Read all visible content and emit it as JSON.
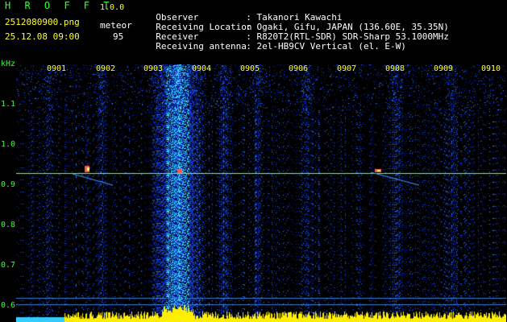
{
  "header": {
    "app_title": "H R O F F T",
    "app_version": "1.0.0",
    "file_name": "2512080900.png",
    "meteor_label": "meteor",
    "datetime": "25.12.08 09:00",
    "meteor_count": "95"
  },
  "info": [
    {
      "key": "Observer",
      "value": ": Takanori Kawachi"
    },
    {
      "key": "Receiving Location",
      "value": ": Ogaki, Gifu, JAPAN (136.60E, 35.35N)"
    },
    {
      "key": "Receiver",
      "value": ": R820T2(RTL-SDR) SDR-Sharp 53.1000MHz"
    },
    {
      "key": "Receiving antenna",
      "value": ": 2el-HB9CV Vertical (el. E-W)"
    }
  ],
  "y_axis": {
    "unit": "kHz",
    "ticks": [
      "1.1",
      "1.0",
      "0.9",
      "0.8",
      "0.7",
      "0.6"
    ]
  },
  "x_axis": {
    "ticks": [
      "0901",
      "0902",
      "0903",
      "0904",
      "0905",
      "0906",
      "0907",
      "0908",
      "0909",
      "0910"
    ]
  },
  "colors": {
    "header_green": "#33ff33",
    "header_white": "#ffffff",
    "tick_yellow": "#ffff33",
    "carrier_line": "#66ff66",
    "noise_blue": "#1030c0",
    "hot_cyan": "#40e0ff"
  }
}
